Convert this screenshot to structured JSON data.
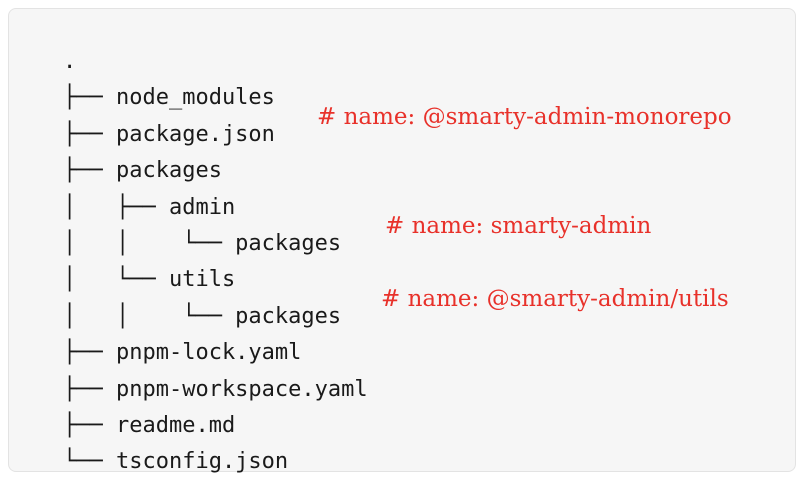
{
  "tree": {
    "lines": [
      {
        "text": ".",
        "comment": ""
      },
      {
        "text": "├── node_modules",
        "comment": ""
      },
      {
        "text": "├── package.json",
        "comment": "# name: @smarty-admin-monorepo"
      },
      {
        "text": "├── packages",
        "comment": ""
      },
      {
        "text": "│   ├── admin",
        "comment": ""
      },
      {
        "text": "│   │    └── packages",
        "comment": "# name: smarty-admin"
      },
      {
        "text": "│   └── utils",
        "comment": ""
      },
      {
        "text": "│   │    └── packages",
        "comment": "# name: @smarty-admin/utils"
      },
      {
        "text": "├── pnpm-lock.yaml",
        "comment": ""
      },
      {
        "text": "├── pnpm-workspace.yaml",
        "comment": ""
      },
      {
        "text": "├── readme.md",
        "comment": ""
      },
      {
        "text": "└── tsconfig.json",
        "comment": ""
      }
    ]
  },
  "colors": {
    "comment": "#e8312a",
    "code": "#1a1a1a",
    "background": "#f6f6f6"
  }
}
